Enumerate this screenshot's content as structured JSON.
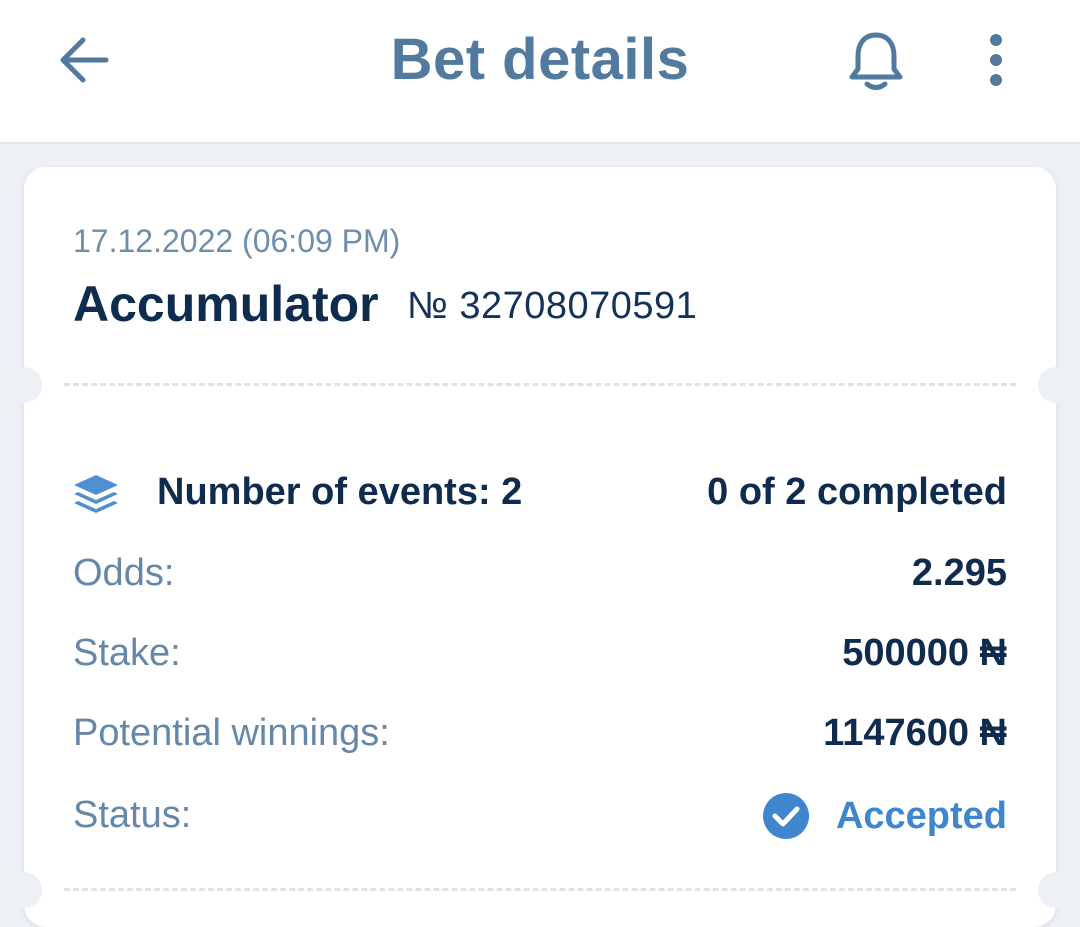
{
  "header": {
    "title": "Bet details",
    "back_icon": "arrow-left-icon",
    "bell_icon": "bell-icon",
    "menu_icon": "more-vertical-icon"
  },
  "bet": {
    "date": "17.12.2022 (06:09 PM)",
    "type": "Accumulator",
    "number": "№ 32708070591",
    "events_label": "Number of events: 2",
    "events_progress": "0 of 2 completed",
    "odds_label": "Odds:",
    "odds_value": "2.295",
    "stake_label": "Stake:",
    "stake_value": "500000 ₦",
    "winnings_label": "Potential winnings:",
    "winnings_value": "1147600 ₦",
    "status_label": "Status:",
    "status_value": "Accepted"
  },
  "colors": {
    "header_text": "#52799e",
    "dark_text": "#0f2c4f",
    "muted_text": "#6688a8",
    "accent": "#3f86cf",
    "background": "#edf0f4"
  }
}
